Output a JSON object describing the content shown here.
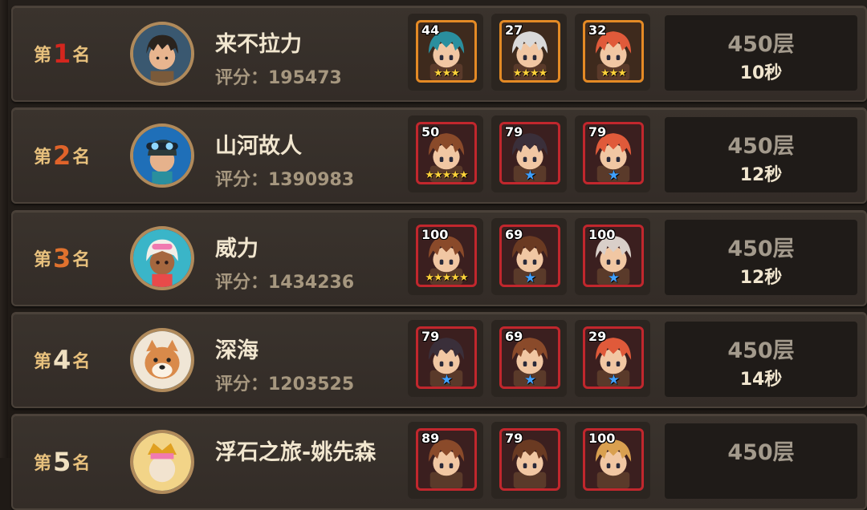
{
  "rows": [
    {
      "rank_prefix": "第",
      "rank_number": "1",
      "rank_suffix": "名",
      "rank_color": "#d4261e",
      "name": "来不拉力",
      "score": "评分：195473",
      "heroes": [
        {
          "level": "44",
          "frame": "orange",
          "stars": "★★★",
          "star_type": "gold",
          "hair": "#2a8f9e"
        },
        {
          "level": "27",
          "frame": "orange",
          "stars": "★★★★",
          "star_type": "gold",
          "hair": "#d9d9d9"
        },
        {
          "level": "32",
          "frame": "orange",
          "stars": "★★★",
          "star_type": "gold",
          "hair": "#e05a3a"
        }
      ],
      "floor": "450层",
      "time": "10秒"
    },
    {
      "rank_prefix": "第",
      "rank_number": "2",
      "rank_suffix": "名",
      "rank_color": "#e0632a",
      "name": "山河故人",
      "score": "评分：1390983",
      "heroes": [
        {
          "level": "50",
          "frame": "red",
          "stars": "★★★★★",
          "star_type": "gold",
          "hair": "#8a4a2a"
        },
        {
          "level": "79",
          "frame": "red",
          "stars": "★",
          "star_type": "blue",
          "hair": "#3a2f3a"
        },
        {
          "level": "79",
          "frame": "red",
          "stars": "★",
          "star_type": "blue",
          "hair": "#e05a3a"
        }
      ],
      "floor": "450层",
      "time": "12秒"
    },
    {
      "rank_prefix": "第",
      "rank_number": "3",
      "rank_suffix": "名",
      "rank_color": "#e0722e",
      "name": "威力",
      "score": "评分：1434236",
      "heroes": [
        {
          "level": "100",
          "frame": "red",
          "stars": "★★★★★",
          "star_type": "gold",
          "hair": "#8a4a2a"
        },
        {
          "level": "69",
          "frame": "red",
          "stars": "★",
          "star_type": "blue",
          "hair": "#6a3a22"
        },
        {
          "level": "100",
          "frame": "red",
          "stars": "★",
          "star_type": "blue",
          "hair": "#d9cfc9"
        }
      ],
      "floor": "450层",
      "time": "12秒"
    },
    {
      "rank_prefix": "第",
      "rank_number": "4",
      "rank_suffix": "名",
      "rank_color": "#efe0c0",
      "name": "深海",
      "score": "评分：1203525",
      "heroes": [
        {
          "level": "79",
          "frame": "red",
          "stars": "★",
          "star_type": "blue",
          "hair": "#3a2f3a"
        },
        {
          "level": "69",
          "frame": "red",
          "stars": "★",
          "star_type": "blue",
          "hair": "#8a4a2a"
        },
        {
          "level": "29",
          "frame": "red",
          "stars": "★",
          "star_type": "blue",
          "hair": "#e05a3a"
        }
      ],
      "floor": "450层",
      "time": "14秒"
    },
    {
      "rank_prefix": "第",
      "rank_number": "5",
      "rank_suffix": "名",
      "rank_color": "#efe0c0",
      "name": "浮石之旅-姚先森",
      "score": "",
      "heroes": [
        {
          "level": "89",
          "frame": "red",
          "stars": "",
          "star_type": "blue",
          "hair": "#8a4a2a"
        },
        {
          "level": "79",
          "frame": "red",
          "stars": "",
          "star_type": "blue",
          "hair": "#6a3a22"
        },
        {
          "level": "100",
          "frame": "red",
          "stars": "",
          "star_type": "blue",
          "hair": "#d9a050"
        }
      ],
      "floor": "450层",
      "time": ""
    }
  ],
  "avatars": [
    "dark-hair-warrior",
    "goggles-adventurer",
    "sunglasses-girl",
    "shiba-dog",
    "golden-crown-character"
  ],
  "colors": {
    "row_bg": "#3a332d",
    "rank_text": "#e8c17d",
    "name_text": "#f1e6cf",
    "score_text": "#a6977f",
    "floor_text": "#a39a8c"
  }
}
